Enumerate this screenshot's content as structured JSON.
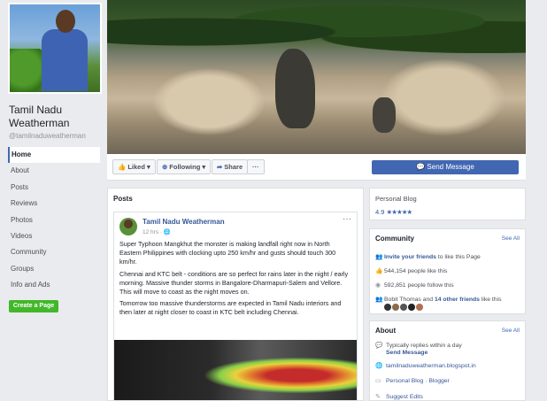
{
  "page": {
    "name": "Tamil Nadu Weatherman",
    "handle": "@tamilnaduweatherman",
    "create_page": "Create a Page"
  },
  "leftnav": [
    "Home",
    "About",
    "Posts",
    "Reviews",
    "Photos",
    "Videos",
    "Community",
    "Groups",
    "Info and Ads"
  ],
  "actions": {
    "liked": "Liked",
    "following": "Following",
    "share": "Share",
    "more": "···",
    "send_message": "Send Message"
  },
  "posts": {
    "header": "Posts",
    "author": "Tamil Nadu Weatherman",
    "time": "12 hrs",
    "menu": "···",
    "paragraphs": [
      "Super Typhoon Mangkhut the monster is making landfall right now in North Eastern Philippines with clocking upto 250 km/hr and gusts should touch 300 km/hr.",
      "Chennai and KTC belt - conditions are so perfect for rains later in the night / early morning. Massive thunder storms in Bangalore-Dharmapuri-Salem and Vellore. This will move to coast as the night moves on.",
      "Tomorrow too massive thunderstorms are expected in Tamil Nadu interiors and then later at night closer to coast in KTC belt including Chennai."
    ]
  },
  "blog": {
    "title": "Personal Blog",
    "rating": "4.9",
    "stars": "★★★★★"
  },
  "community": {
    "title": "Community",
    "see_all": "See All",
    "invite": "Invite your friends",
    "invite_suffix": "to like this Page",
    "likes": "544,154 people like this",
    "follows": "592,851 people follow this",
    "friend1": "Bobit Thomas",
    "and": "and",
    "friends_other": "14 other friends",
    "like_this": "like this"
  },
  "about": {
    "title": "About",
    "see_all": "See All",
    "replies": "Typically replies within a day",
    "send_message": "Send Message",
    "website": "tamilnaduweatherman.blogspot.in",
    "category1": "Personal Blog",
    "dot": "·",
    "category2": "Blogger",
    "suggest": "Suggest Edits"
  },
  "colors": {
    "brand_blue": "#4267b2",
    "create_green": "#42b72a",
    "link": "#365899"
  }
}
